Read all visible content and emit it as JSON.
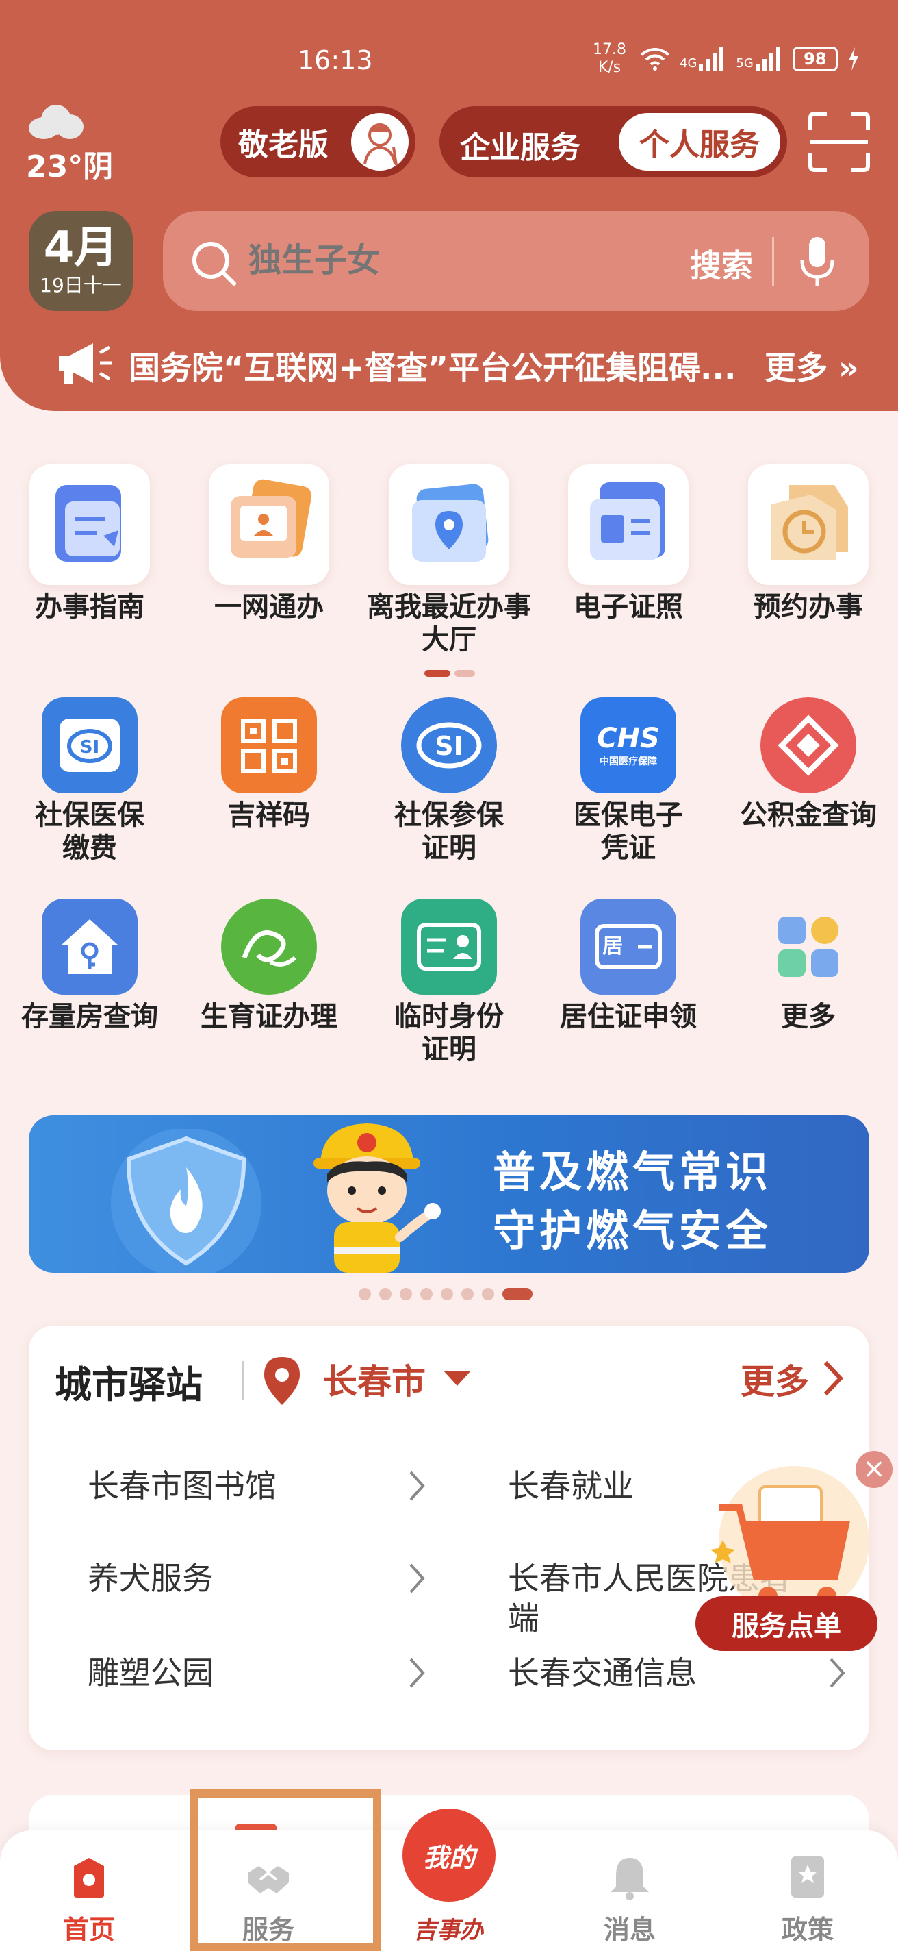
{
  "status_bar": {
    "time": "16:13",
    "net_speed_value": "17.8",
    "net_speed_unit": "K/s",
    "signal_1": "4G",
    "signal_2": "5G",
    "battery": "98"
  },
  "weather": {
    "temperature": "23°阴"
  },
  "mode": {
    "elder": "敬老版"
  },
  "service_toggle": {
    "enterprise": "企业服务",
    "personal": "个人服务"
  },
  "date": {
    "month": "4月",
    "day": "19日十一"
  },
  "search": {
    "placeholder": "独生子女",
    "button": "搜索"
  },
  "notice": {
    "text": "国务院“互联网+督查”平台公开征集阻碍...",
    "more": "更多"
  },
  "quick_services": [
    {
      "label": "办事指南",
      "icon": "guide-icon"
    },
    {
      "label": "一网通办",
      "icon": "online-service-icon"
    },
    {
      "label": "离我最近办事大厅",
      "icon": "location-hall-icon"
    },
    {
      "label": "电子证照",
      "icon": "e-license-icon"
    },
    {
      "label": "预约办事",
      "icon": "appointment-icon"
    }
  ],
  "services": [
    {
      "label": "社保医保缴费",
      "icon": "social-insurance-icon",
      "color": "#3a7fe0"
    },
    {
      "label": "吉祥码",
      "icon": "jixiang-code-icon",
      "color": "#f07a2f"
    },
    {
      "label": "社保参保证明",
      "icon": "social-insurance-cert-icon",
      "color": "#3a7fe0"
    },
    {
      "label": "医保电子凭证",
      "icon": "chs-medical-icon",
      "color": "#2f7ae8",
      "badge": "CHS",
      "badge_sub": "中国医疗保障"
    },
    {
      "label": "公积金查询",
      "icon": "housing-fund-icon",
      "color": "#e85a57"
    },
    {
      "label": "存量房查询",
      "icon": "house-query-icon",
      "color": "#4a7fe0"
    },
    {
      "label": "生育证办理",
      "icon": "birth-cert-icon",
      "color": "#58b640"
    },
    {
      "label": "临时身份证明",
      "icon": "temp-id-icon",
      "color": "#2fae86"
    },
    {
      "label": "居住证申领",
      "icon": "residence-permit-icon",
      "color": "#5a87e2",
      "badge": "居"
    },
    {
      "label": "更多",
      "icon": "more-grid-icon",
      "color": "#ffffff"
    }
  ],
  "banner": {
    "line1": "普及燃气常识",
    "line2": "守护燃气安全"
  },
  "city_station": {
    "title": "城市驿站",
    "city": "长春市",
    "more": "更多",
    "left_items": [
      "长春市图书馆",
      "养犬服务",
      "雕塑公园"
    ],
    "right_items": [
      "长春就业",
      "长春市人民医院患者端",
      "长春交通信息"
    ]
  },
  "floating": {
    "button": "服务点单"
  },
  "bottom_nav": {
    "home": "首页",
    "service": "服务",
    "center": "我的",
    "center_label": "吉事办",
    "messages": "消息",
    "policy": "政策"
  },
  "colors": {
    "primary": "#c8604c",
    "accent": "#c0442f",
    "background": "#fbeeec"
  }
}
